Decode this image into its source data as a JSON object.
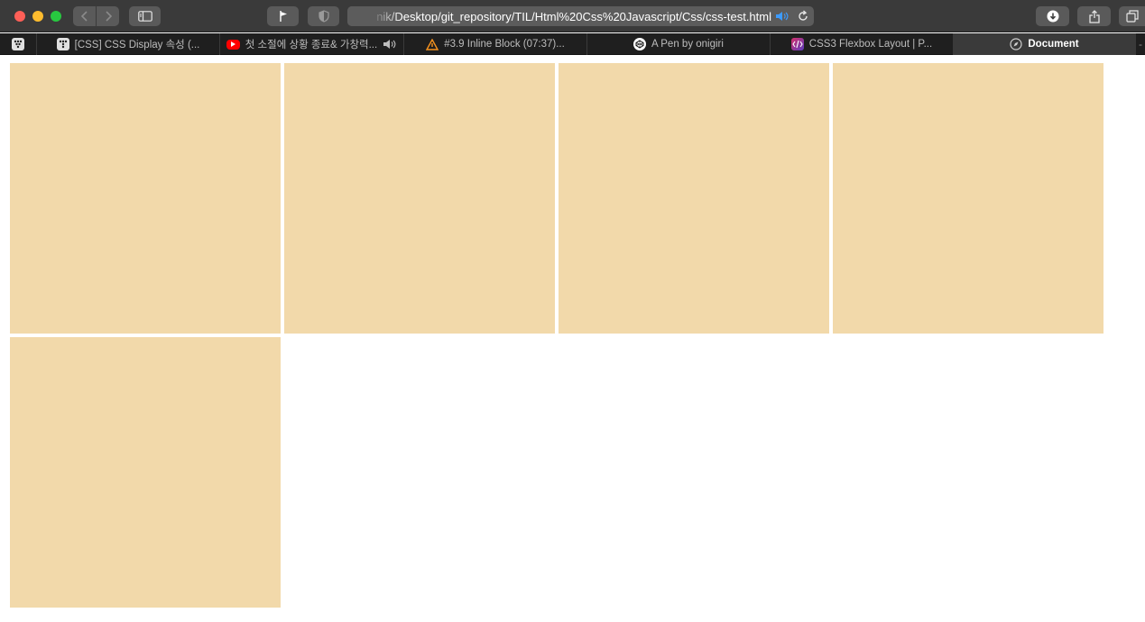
{
  "browser": {
    "address": "nik/Desktop/git_repository/TIL/Html%20Css%20Javascript/Css/css-test.html",
    "tabs": [
      {
        "label": "[CSS] CSS Display 속성 (...",
        "favicon": "tistory-icon",
        "active": false
      },
      {
        "label": "첫 소절에 상황 종료& 가창력...",
        "favicon": "youtube-icon",
        "active": false
      },
      {
        "label": "#3.9 Inline Block (07:37)...",
        "favicon": "nomad-icon",
        "active": false
      },
      {
        "label": "A Pen by onigiri",
        "favicon": "codepen-icon",
        "active": false
      },
      {
        "label": "CSS3 Flexbox Layout | P...",
        "favicon": "code-icon",
        "active": false
      },
      {
        "label": "Document",
        "favicon": "compass-icon",
        "active": true
      }
    ]
  },
  "page": {
    "box_color": "#f2d9aa",
    "box_count": 5
  },
  "colors": {
    "toolbar": "#3a3a3a",
    "tabbar": "#1f1f1f",
    "youtube": "#ff0000",
    "nomad": "#f7931e"
  }
}
